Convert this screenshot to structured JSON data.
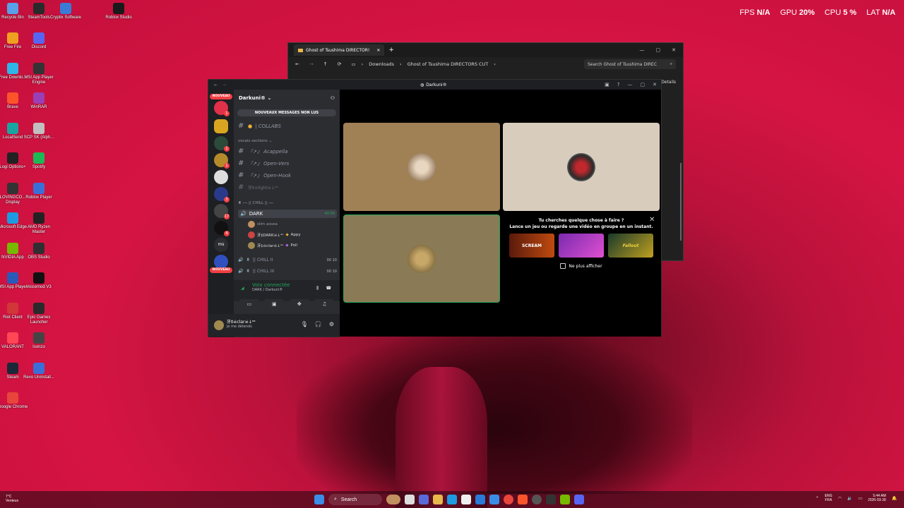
{
  "perf": {
    "fps_label": "FPS",
    "fps": "N/A",
    "gpu_label": "GPU",
    "gpu": "20",
    "cpu_label": "CPU",
    "cpu": "5",
    "lat_label": "LAT",
    "lat": "N/A",
    "pct": "%"
  },
  "desktop": [
    {
      "label": "Recycle Bin",
      "color": "#5aa0e8"
    },
    {
      "label": "SteamTools",
      "color": "#2a2a2a"
    },
    {
      "label": "Cryptix Software",
      "color": "#3a7bd5"
    },
    {
      "label": "Roblox Studio",
      "color": "#1a1a1a"
    },
    {
      "label": "Free Fire",
      "color": "#f0a020"
    },
    {
      "label": "Discord",
      "color": "#5865f2"
    },
    {
      "label": "Free Downlo...",
      "color": "#2fb5e8"
    },
    {
      "label": "MSI App Player Engine",
      "color": "#333"
    },
    {
      "label": "Brave",
      "color": "#fb542b"
    },
    {
      "label": "WinRAR",
      "color": "#9a3fb5"
    },
    {
      "label": "LocalSend",
      "color": "#1aa5a0"
    },
    {
      "label": "SCP SK (Alph...",
      "color": "#c0c0c0"
    },
    {
      "label": "Logi Options+",
      "color": "#222"
    },
    {
      "label": "Spotify",
      "color": "#1db954"
    },
    {
      "label": "LOVINGCO... Display",
      "color": "#333"
    },
    {
      "label": "Roblox Player",
      "color": "#3a6fd8"
    },
    {
      "label": "Microsoft Edge",
      "color": "#1e9be0"
    },
    {
      "label": "AMD Ryzen Master",
      "color": "#222"
    },
    {
      "label": "NVIDIA App",
      "color": "#76b900"
    },
    {
      "label": "OBS Studio",
      "color": "#302e31"
    },
    {
      "label": "MSI App Player",
      "color": "#2a5ab8"
    },
    {
      "label": "Voicemod V3",
      "color": "#111"
    },
    {
      "label": "Riot Client",
      "color": "#d13639"
    },
    {
      "label": "Epic Games Launcher",
      "color": "#2a2a2a"
    },
    {
      "label": "VALORANT",
      "color": "#ff4655"
    },
    {
      "label": "Isonzo",
      "color": "#444"
    },
    {
      "label": "Steam",
      "color": "#1b2838"
    },
    {
      "label": "Revo Uninstall...",
      "color": "#3a6fd8"
    },
    {
      "label": "Google Chrome",
      "color": "#e8453c"
    }
  ],
  "explorer": {
    "tab_title": "Ghost of Tsushima DIRECTOR!",
    "breadcrumb_root": "Downloads",
    "breadcrumb_leaf": "Ghost of Tsushima DIRECTORS CUT",
    "search_placeholder": "Search Ghost of Tsushima DIREC",
    "details": "Details"
  },
  "discord": {
    "window_title": "Darkuni®",
    "server_name": "Darkuni®",
    "nouveau": "NOUVEAU",
    "new_messages": "NOUVEAUX MESSAGES NON LUS",
    "ch_collabs": "| COLLABS",
    "cat_vocals": "vocals sections",
    "ch_acappella": "『↗』 Acappella",
    "ch_openvers": "『↗』 Open-Vers",
    "ch_openhook": "『↗』 Open-Hook",
    "ch_light": "牙‡☠light☠↓ᵃᵃ",
    "cat_chill": "── || CHILL || ──",
    "voice_dark": "DARK",
    "voice_dark_time": "40:56",
    "user1": "slim assea",
    "user2": "牙‡DARK☠↓ᵃᵃ",
    "user2_status": "Appy",
    "user3": "牙‡☠clar☠↓ᵃᵃ",
    "user3_status": "Poll",
    "ch_chill2": "|| CHILL II",
    "ch_chill3": "|| CHILL III",
    "count_00": "00",
    "count_10": "10",
    "voice_connected": "Voix connectée",
    "voice_where": "DARK / Darkuni®",
    "me_name": "牙‡☠clar☠↓ᵃᵃ",
    "me_status": "je me détends",
    "activity_title": "Tu cherches quelque chose à faire ?",
    "activity_sub": "Lance un jeu ou regarde une vidéo en groupe en un instant.",
    "game1": "SCREAM",
    "game2": "",
    "game3": "Fallout",
    "dont_show": "Ne plus afficher"
  },
  "taskbar": {
    "weather_temp": "7°C",
    "weather_desc": "Venteux",
    "search": "Search",
    "lang1": "ENG",
    "lang2": "FRA",
    "time": "5:44 AM",
    "date": "2026-03-30"
  }
}
